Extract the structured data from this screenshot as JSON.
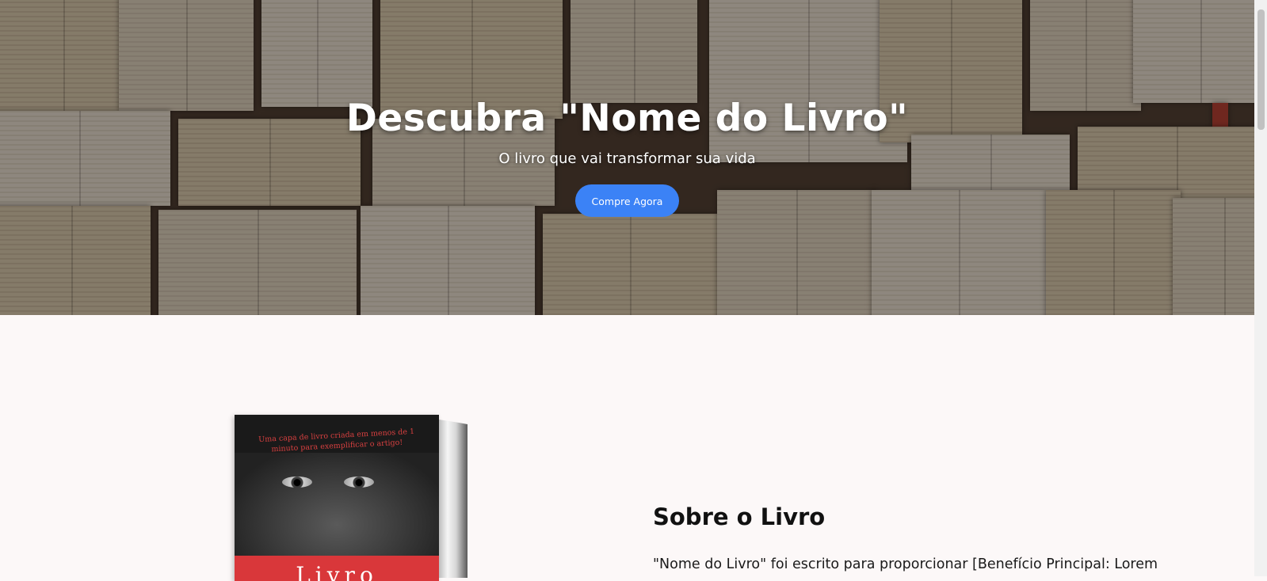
{
  "hero": {
    "title": "Descubra \"Nome do Livro\"",
    "subtitle": "O livro que vai transformar sua vida",
    "cta_label": "Compre Agora",
    "cta_color": "#3b82f6"
  },
  "about": {
    "heading": "Sobre o Livro",
    "text": "\"Nome do Livro\" foi escrito para proporcionar [Benefício Principal: Lorem",
    "cover_tagline": "Uma capa de livro criada em menos de 1 minuto para exemplificar o artigo!",
    "cover_title": "Livro"
  },
  "colors": {
    "page_background": "#fcf8f8",
    "cover_band": "#d9373a"
  }
}
